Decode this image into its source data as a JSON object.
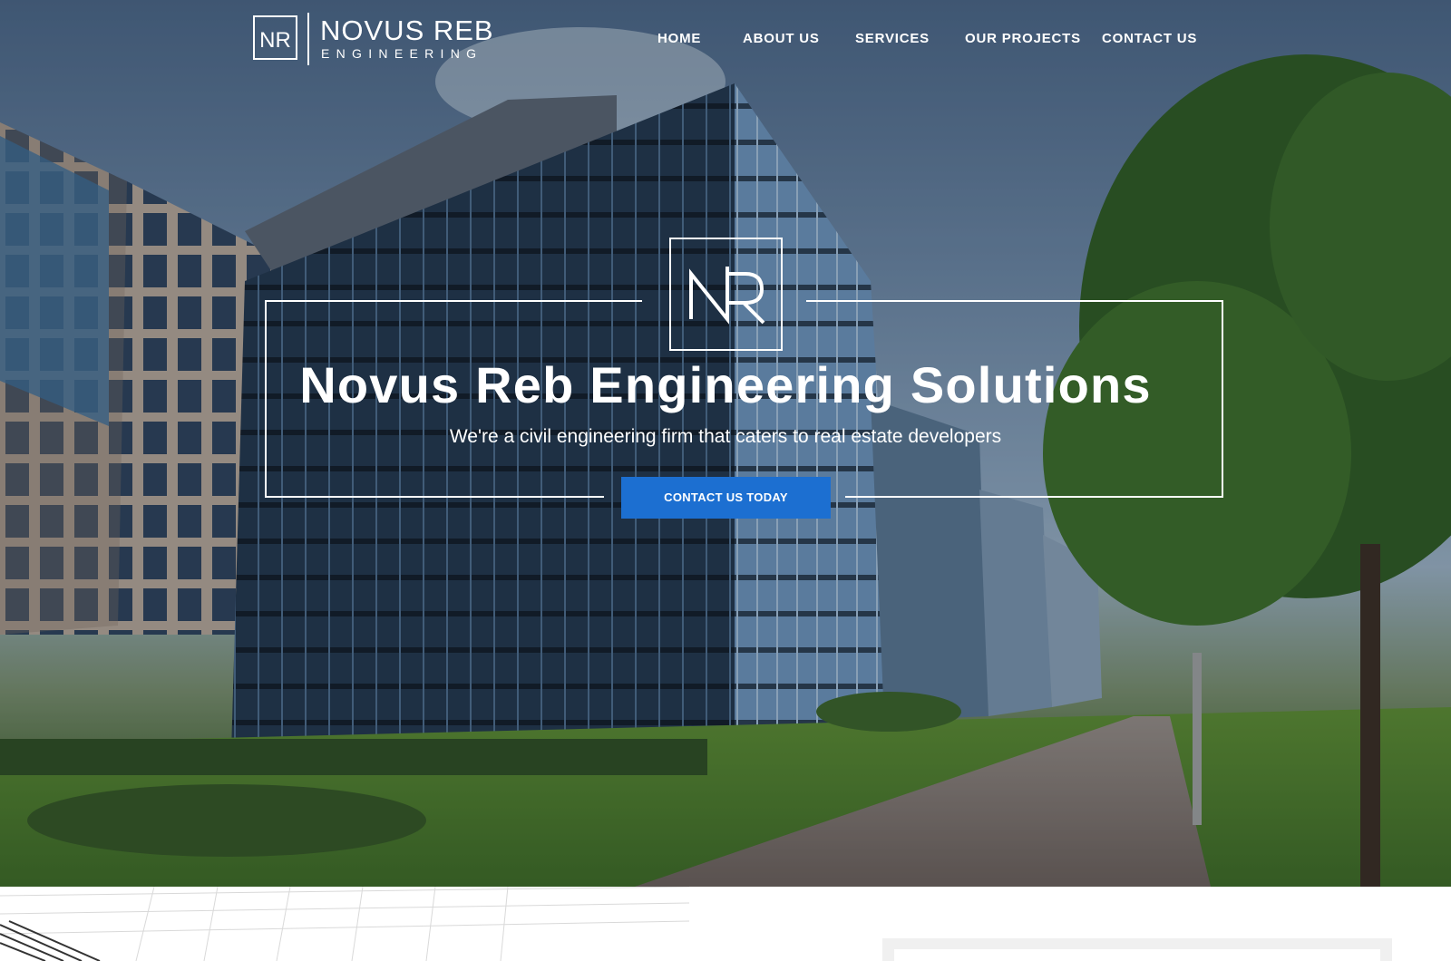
{
  "brand": {
    "name": "NOVUS REB",
    "tagline": "ENGINEERING",
    "monogram": "NR"
  },
  "nav": {
    "items": [
      {
        "label": "HOME"
      },
      {
        "label": "ABOUT US"
      },
      {
        "label": "SERVICES"
      },
      {
        "label": "OUR PROJECTS"
      },
      {
        "label": "CONTACT US"
      }
    ]
  },
  "hero": {
    "title": "Novus Reb Engineering Solutions",
    "subtitle": "We're a civil engineering firm that caters to real estate developers",
    "cta_label": "CONTACT US TODAY",
    "background_icon": "office-building-photo"
  },
  "colors": {
    "accent": "#1c6fd1",
    "text_on_hero": "#ffffff"
  }
}
